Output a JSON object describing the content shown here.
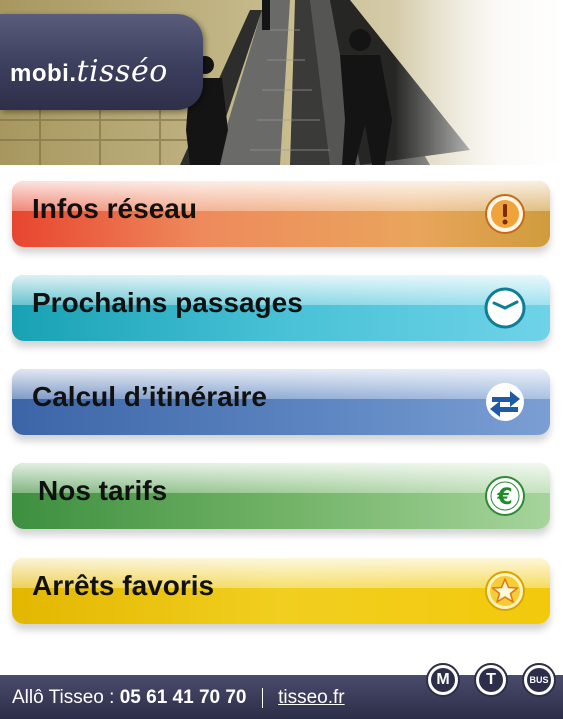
{
  "header": {
    "logo_prefix": "mobi.",
    "logo_script": "tisséo"
  },
  "menu": [
    {
      "label": "Infos réseau",
      "icon": "alert-icon"
    },
    {
      "label": "Prochains passages",
      "icon": "clock-icon"
    },
    {
      "label": "Calcul d’itinéraire",
      "icon": "route-arrows-icon"
    },
    {
      "label": "Nos tarifs",
      "icon": "euro-icon"
    },
    {
      "label": "Arrêts favoris",
      "icon": "star-icon"
    }
  ],
  "footer": {
    "allo_label": "Allô Tisseo :",
    "phone": "05 61 41 70 70",
    "website": "tisseo.fr",
    "badges": [
      "M",
      "T",
      "BUS"
    ]
  },
  "colors": {
    "brand_navy": "#2d2e4a",
    "infos": "#e8452f",
    "passages": "#18a1b4",
    "itineraire": "#3c65a8",
    "tarifs": "#3d8f3f",
    "favoris": "#e3b700"
  }
}
